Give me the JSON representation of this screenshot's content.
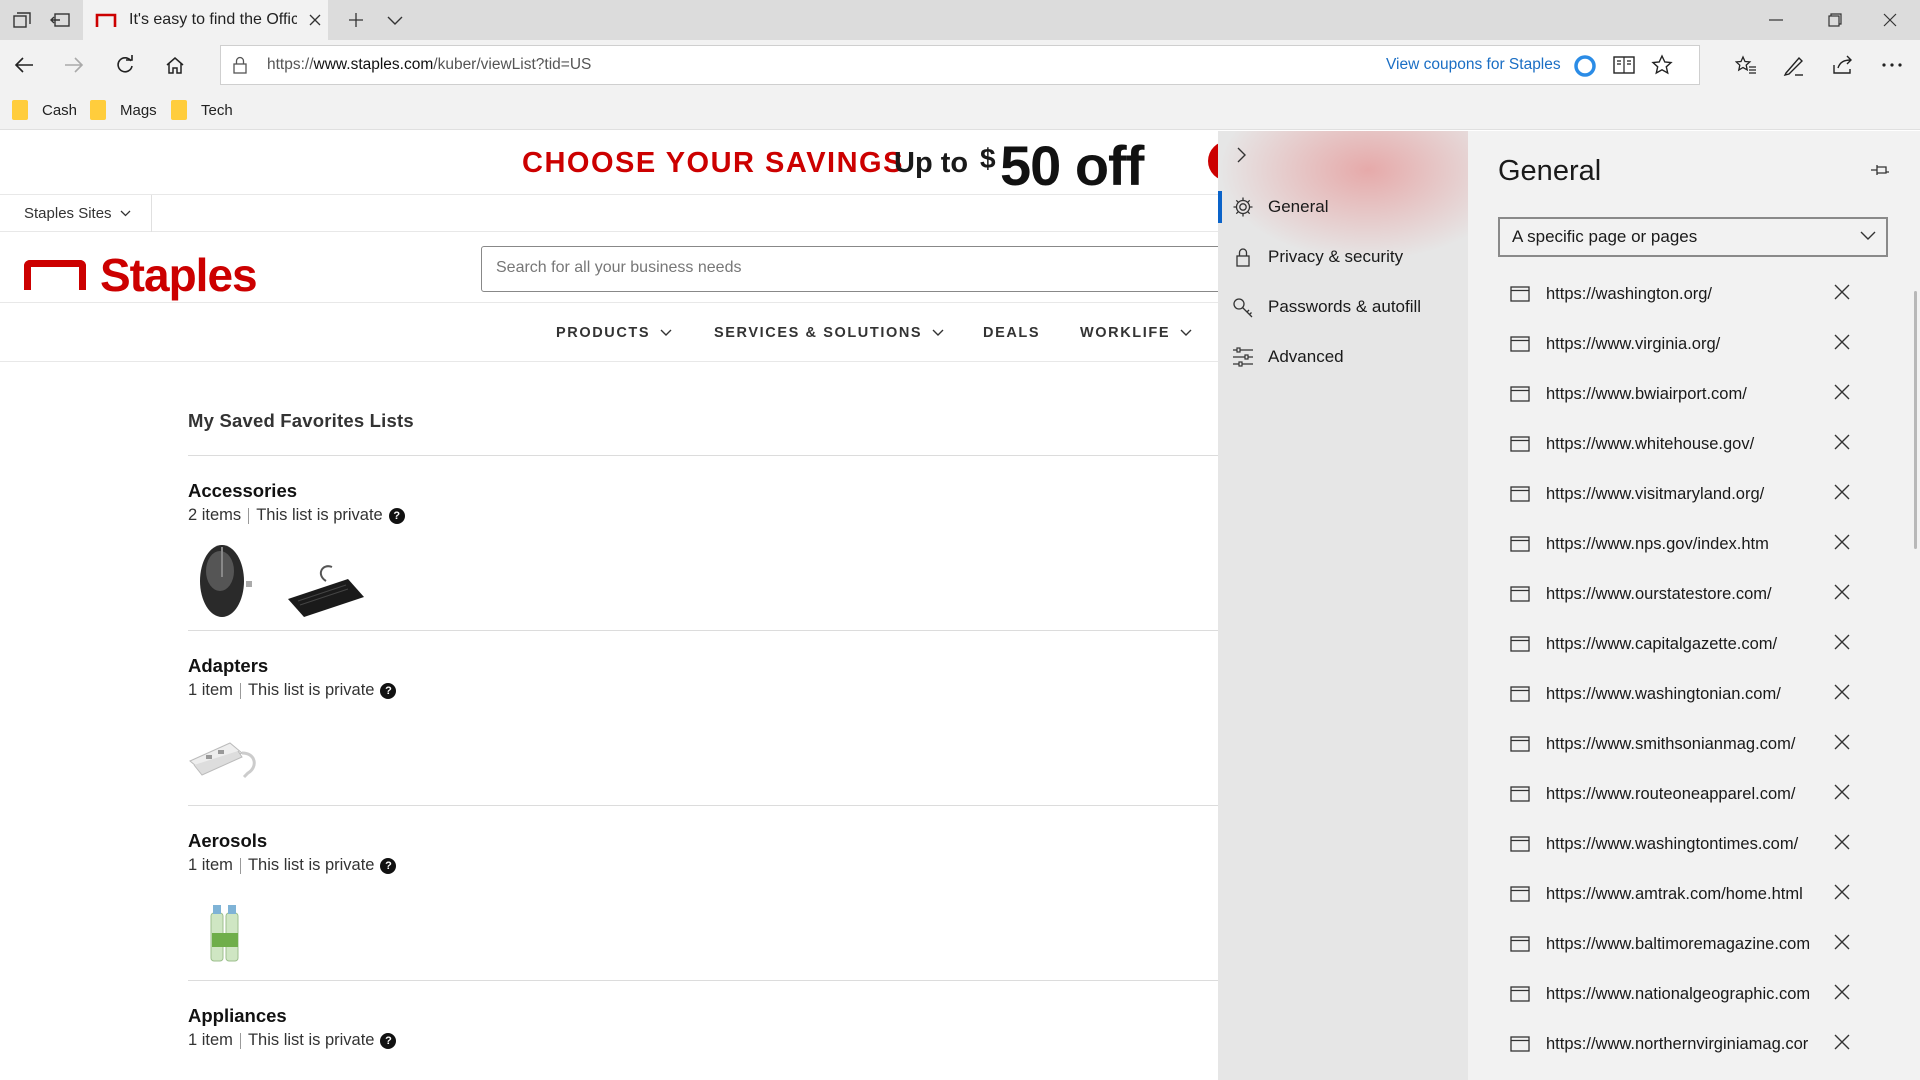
{
  "browser": {
    "tab_title": "It's easy to find the Offic",
    "url_prefix": "https://",
    "url_domain": "www.staples.com",
    "url_path": "/kuber/viewList?tid=US",
    "coupon_text": "View coupons for Staples",
    "favorites": [
      "Cash",
      "Mags",
      "Tech"
    ]
  },
  "page": {
    "promo": {
      "headline": "CHOOSE YOUR SAVINGS",
      "upto": "Up to",
      "dollar": "$",
      "amount": "50 off"
    },
    "sites_label": "Staples Sites",
    "logo_text": "Staples",
    "search_placeholder": "Search for all your business needs",
    "nav": {
      "products": "PRODUCTS",
      "services": "SERVICES & SOLUTIONS",
      "deals": "DEALS",
      "worklife": "WORKLIFE"
    },
    "section_title": "My Saved Favorites Lists",
    "lists": [
      {
        "name": "Accessories",
        "count": "2 items",
        "privacy": "This list is private"
      },
      {
        "name": "Adapters",
        "count": "1 item",
        "privacy": "This list is private"
      },
      {
        "name": "Aerosols",
        "count": "1 item",
        "privacy": "This list is private"
      },
      {
        "name": "Appliances",
        "count": "1 item",
        "privacy": "This list is private"
      }
    ],
    "help_glyph": "?"
  },
  "settings": {
    "menu": {
      "general": "General",
      "privacy": "Privacy & security",
      "passwords": "Passwords & autofill",
      "advanced": "Advanced"
    },
    "heading": "General",
    "startup_option": "A specific page or pages",
    "startup_urls": [
      "https://washington.org/",
      "https://www.virginia.org/",
      "https://www.bwiairport.com/",
      "https://www.whitehouse.gov/",
      "https://www.visitmaryland.org/",
      "https://www.nps.gov/index.htm",
      "https://www.ourstatestore.com/",
      "https://www.capitalgazette.com/",
      "https://www.washingtonian.com/",
      "https://www.smithsonianmag.com/",
      "https://www.routeoneapparel.com/",
      "https://www.washingtontimes.com/",
      "https://www.amtrak.com/home.html",
      "https://www.baltimoremagazine.com",
      "https://www.nationalgeographic.com",
      "https://www.northernvirginiamag.cor"
    ],
    "accent_color": "#0a63c9"
  },
  "colors": {
    "brand_red": "#cc0000",
    "link_blue": "#1a6ec4"
  }
}
